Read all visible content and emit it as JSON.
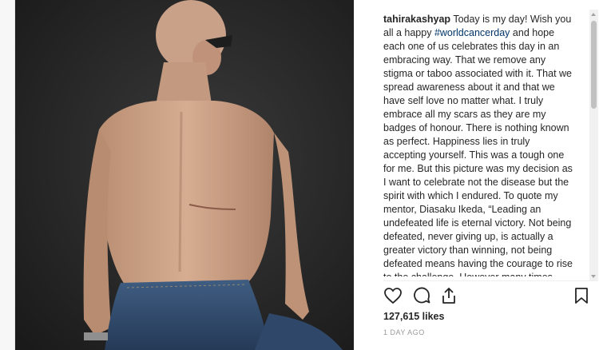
{
  "post": {
    "username": "tahirakashyap",
    "caption_before": " Today is my day! Wish you all a happy ",
    "hashtag": "#worldcancerday",
    "caption_after": " and hope each one of us celebrates this day in an embracing way. That we remove any stigma or taboo associated with it. That we spread awareness about it and that we have self love no matter what. I truly embrace all my scars as they are my badges of honour. There is nothing known as perfect. Happiness lies in truly accepting yourself. This was a tough one for me. But this picture was my decision as I want to celebrate not the disease but the spirit with which I endured. To quote my mentor, Diasaku Ikeda, “Leading an undefeated life is eternal victory. Not being defeated, never giving up, is actually a greater victory than winning, not being defeated means having the courage to rise to the challenge. However many times we’re knocked down,",
    "likes": "127,615 likes",
    "time": "1 DAY AGO"
  },
  "icons": {
    "like": "heart-icon",
    "comment": "comment-icon",
    "share": "share-icon",
    "save": "bookmark-icon"
  }
}
